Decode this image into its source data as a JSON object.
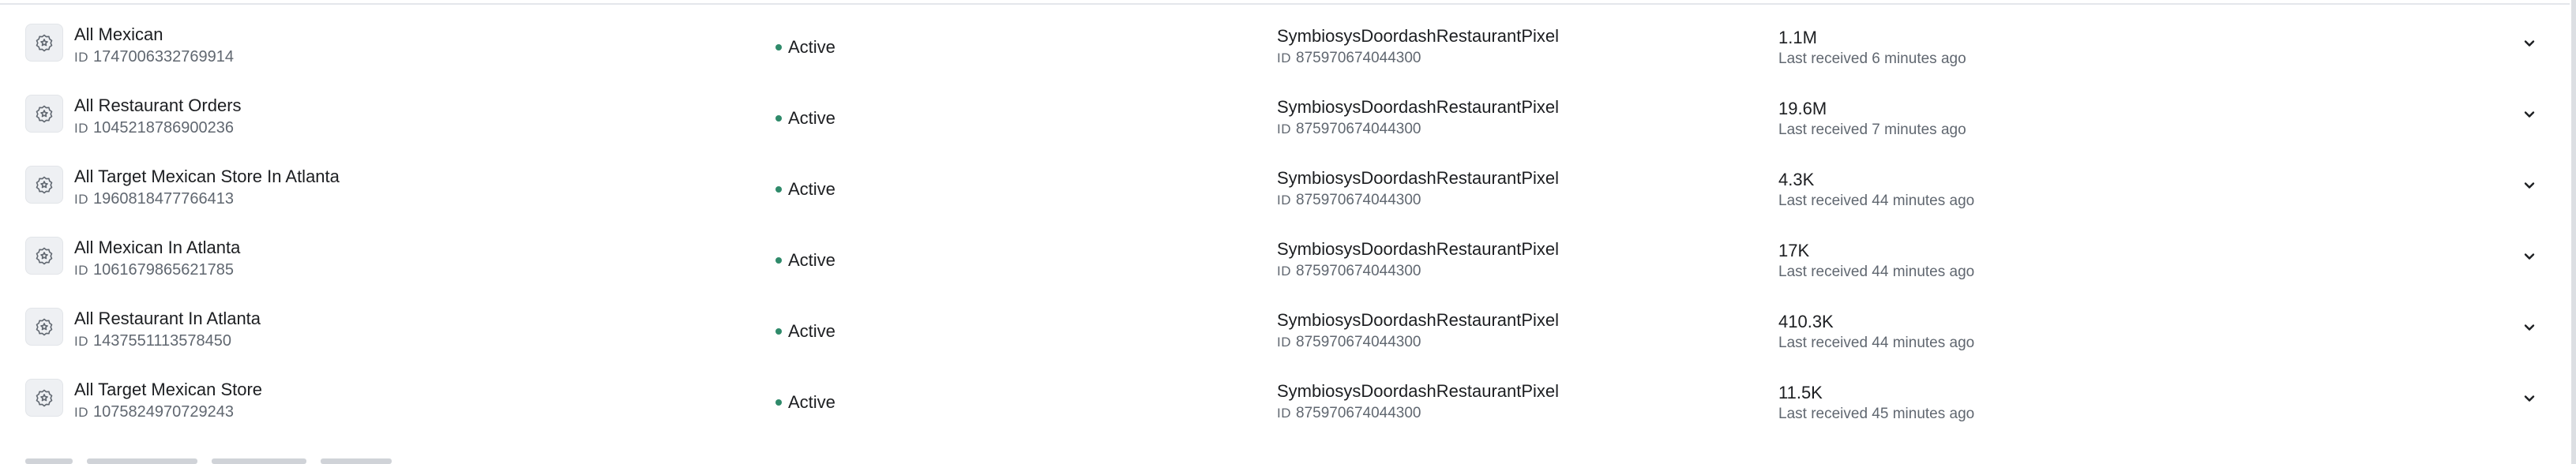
{
  "table": {
    "rows": [
      {
        "name": "All Mexican",
        "id_label": "ID",
        "id": "1747006332769914",
        "status": "Active",
        "pixel_name": "SymbiosysDoordashRestaurantPixel",
        "pixel_id_label": "ID",
        "pixel_id": "875970674044300",
        "events": "1.1M",
        "last_received": "Last received 6 minutes ago"
      },
      {
        "name": "All Restaurant Orders",
        "id_label": "ID",
        "id": "1045218786900236",
        "status": "Active",
        "pixel_name": "SymbiosysDoordashRestaurantPixel",
        "pixel_id_label": "ID",
        "pixel_id": "875970674044300",
        "events": "19.6M",
        "last_received": "Last received 7 minutes ago"
      },
      {
        "name": "All Target Mexican Store In Atlanta",
        "id_label": "ID",
        "id": "1960818477766413",
        "status": "Active",
        "pixel_name": "SymbiosysDoordashRestaurantPixel",
        "pixel_id_label": "ID",
        "pixel_id": "875970674044300",
        "events": "4.3K",
        "last_received": "Last received 44 minutes ago"
      },
      {
        "name": "All Mexican In Atlanta",
        "id_label": "ID",
        "id": "1061679865621785",
        "status": "Active",
        "pixel_name": "SymbiosysDoordashRestaurantPixel",
        "pixel_id_label": "ID",
        "pixel_id": "875970674044300",
        "events": "17K",
        "last_received": "Last received 44 minutes ago"
      },
      {
        "name": "All Restaurant In Atlanta",
        "id_label": "ID",
        "id": "1437551113578450",
        "status": "Active",
        "pixel_name": "SymbiosysDoordashRestaurantPixel",
        "pixel_id_label": "ID",
        "pixel_id": "875970674044300",
        "events": "410.3K",
        "last_received": "Last received 44 minutes ago"
      },
      {
        "name": "All Target Mexican Store",
        "id_label": "ID",
        "id": "1075824970729243",
        "status": "Active",
        "pixel_name": "SymbiosysDoordashRestaurantPixel",
        "pixel_id_label": "ID",
        "pixel_id": "875970674044300",
        "events": "11.5K",
        "last_received": "Last received 45 minutes ago"
      }
    ],
    "row_icon": "badge-star-icon",
    "expand_icon": "chevron-down-icon",
    "status_color": "#2f8a6a"
  }
}
